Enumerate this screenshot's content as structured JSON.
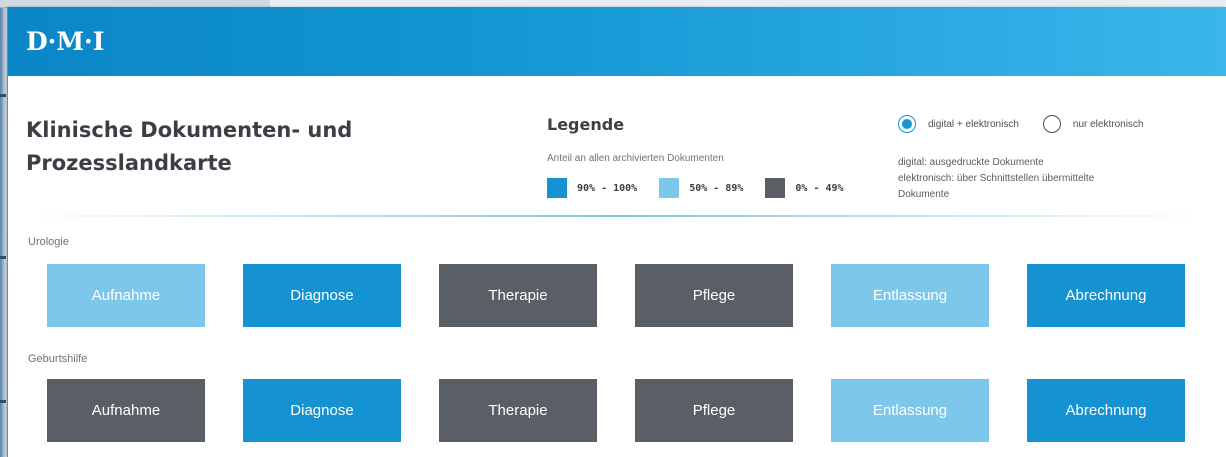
{
  "colors": {
    "high": "#1592d2",
    "mid": "#7dc7ea",
    "low": "#5a5f66",
    "header": "#1396d3"
  },
  "app": {
    "logo": "D·M·I"
  },
  "page": {
    "title_line1": "Klinische Dokumenten- und",
    "title_line2": "Prozesslandkarte"
  },
  "legend": {
    "title": "Legende",
    "subtitle": "Anteil an allen archivierten Dokumenten",
    "items": [
      {
        "level": "high",
        "label": "90% - 100%"
      },
      {
        "level": "mid",
        "label": "50% - 89%"
      },
      {
        "level": "low",
        "label": "0% - 49%"
      }
    ]
  },
  "filter": {
    "options": [
      {
        "label": "digital + elektronisch",
        "selected": true
      },
      {
        "label": "nur elektronisch",
        "selected": false
      }
    ],
    "note_line1": "digital: ausgedruckte Dokumente",
    "note_line2": "elektronisch: über Schnittstellen übermittelte",
    "note_line3": "Dokumente"
  },
  "departments": [
    {
      "name": "Urologie",
      "processes": [
        {
          "label": "Aufnahme",
          "level": "mid"
        },
        {
          "label": "Diagnose",
          "level": "high"
        },
        {
          "label": "Therapie",
          "level": "low"
        },
        {
          "label": "Pflege",
          "level": "low"
        },
        {
          "label": "Entlassung",
          "level": "mid"
        },
        {
          "label": "Abrechnung",
          "level": "high"
        }
      ]
    },
    {
      "name": "Geburtshilfe",
      "processes": [
        {
          "label": "Aufnahme",
          "level": "low"
        },
        {
          "label": "Diagnose",
          "level": "high"
        },
        {
          "label": "Therapie",
          "level": "low"
        },
        {
          "label": "Pflege",
          "level": "low"
        },
        {
          "label": "Entlassung",
          "level": "mid"
        },
        {
          "label": "Abrechnung",
          "level": "high"
        }
      ]
    }
  ]
}
